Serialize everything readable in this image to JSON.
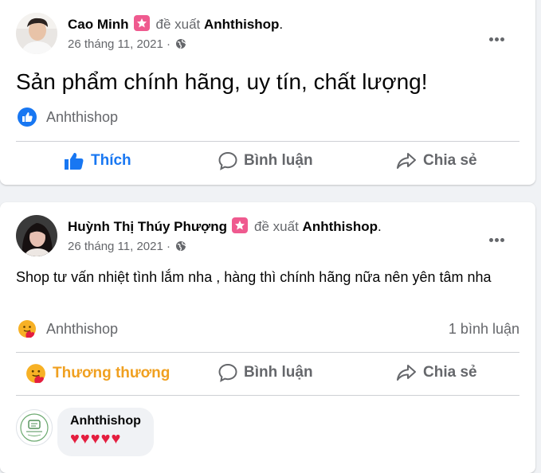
{
  "posts": [
    {
      "author": "Cao Minh",
      "recommends": "đề xuất",
      "page": "Anhthishop",
      "date": "26 tháng 11, 2021",
      "text": "Sản phẩm chính hãng, uy tín, chất lượng!",
      "reaction_label": "Anhthishop",
      "reaction_icon": "like-icon",
      "comment_count": "",
      "actions": {
        "like": "Thích",
        "comment": "Bình luận",
        "share": "Chia sẻ"
      }
    },
    {
      "author": "Huỳnh Thị Thúy Phượng",
      "recommends": "đề xuất",
      "page": "Anhthishop",
      "date": "26 tháng 11, 2021",
      "text": "Shop tư vấn nhiệt tình lắm nha , hàng thì chính hãng nữa nên yên tâm nha",
      "reaction_label": "Anhthishop",
      "reaction_icon": "care-icon",
      "comment_count": "1 bình luận",
      "actions": {
        "like": "Thương thương",
        "comment": "Bình luận",
        "share": "Chia sẻ"
      },
      "comment": {
        "author": "Anhthishop",
        "text": "♥♥♥♥♥"
      }
    }
  ],
  "colors": {
    "like_blue": "#1877f2",
    "care_orange": "#f7b125",
    "secondary_text": "#65676b",
    "badge_pink": "#ef5a8f",
    "heart_red": "#e41e3f"
  },
  "punctuation": "."
}
